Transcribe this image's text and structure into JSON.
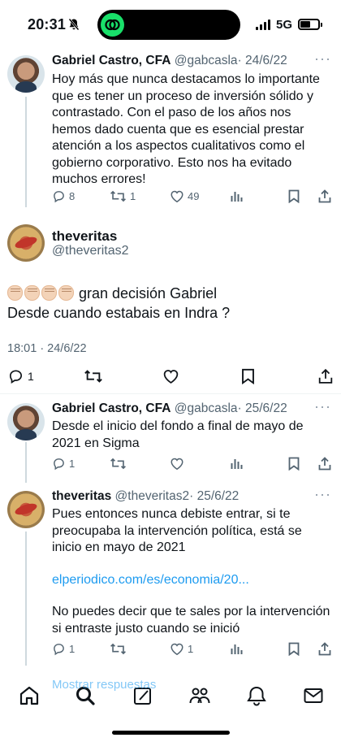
{
  "status_bar": {
    "time": "20:31",
    "network": "5G",
    "battery_level": 0.55
  },
  "tweets": [
    {
      "name": "Gabriel Castro, CFA",
      "handle": "@gabcasla",
      "date": "· 24/6/22",
      "text": "Hoy más que nunca destacamos lo importante que es tener un proceso de inversión sólido y contrastado. Con el paso de los años nos hemos dado cuenta que es esencial prestar atención a los aspectos cualitativos como el gobierno corporativo. Esto nos ha evitado muchos errores!",
      "replies": "8",
      "retweets": "1",
      "likes": "49"
    }
  ],
  "main_tweet": {
    "name": "theveritas",
    "handle": "@theveritas2",
    "text_line1": "gran decisión Gabriel",
    "text_line2": "Desde cuando estabais en Indra ?",
    "time": "18:01 · 24/6/22",
    "replies": "1"
  },
  "replies": [
    {
      "name": "Gabriel Castro, CFA",
      "handle": "@gabcasla",
      "date": "· 25/6/22",
      "text": "Desde el inicio del fondo a final de mayo de 2021 en Sigma",
      "replies": "1"
    },
    {
      "name": "theveritas",
      "handle": "@theveritas2",
      "date": "· 25/6/22",
      "text": "Pues entonces nunca debiste entrar, si te preocupaba la intervención política, está se inicio en mayo de 2021",
      "link": "elperiodico.com/es/economia/20...",
      "text2": "No puedes decir que te sales por la intervención si entraste justo cuando se inició",
      "replies": "1",
      "likes": "1"
    }
  ],
  "show_replies": "Mostrar respuestas",
  "colors": {
    "accent": "#1d9bf0",
    "text": "#0f1419",
    "secondary": "#536471"
  }
}
